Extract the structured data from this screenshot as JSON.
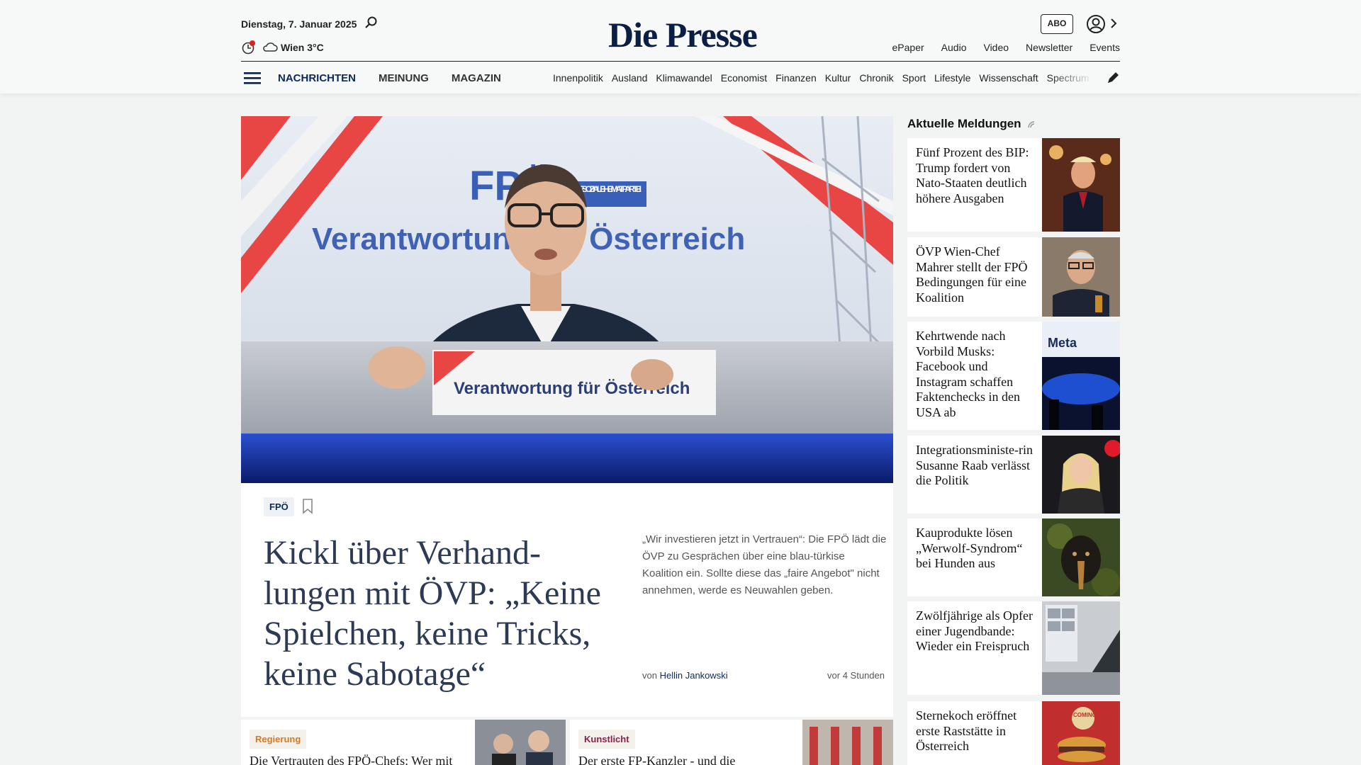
{
  "header": {
    "date": "Dienstag, 7. Januar 2025",
    "weather": "Wien 3°C",
    "logo": "Die Presse",
    "abo": "ABO",
    "links": [
      "ePaper",
      "Audio",
      "Video",
      "Newsletter",
      "Events"
    ]
  },
  "nav": {
    "main": [
      "NACHRICHTEN",
      "MEINUNG",
      "MAGAZIN"
    ],
    "sub": [
      "Innenpolitik",
      "Ausland",
      "Klimawandel",
      "Economist",
      "Finanzen",
      "Kultur",
      "Chronik",
      "Sport",
      "Lifestyle",
      "Wissenschaft",
      "Spectrum"
    ]
  },
  "hero": {
    "banner_text": "Verantwortung für Österreich",
    "podium_text": "Verantwortung für Österreich",
    "party": "FPÖ",
    "party_sub": "DIE SOZIALE HEIMATPARTEI"
  },
  "lead": {
    "tag": "FPÖ",
    "headline": "Kickl über Verhand-lungen mit ÖVP: „Keine Spielchen, keine Tricks, keine Sabotage“",
    "teaser": "„Wir investieren jetzt in Vertrauen“: Die FPÖ lädt die ÖVP zu Gesprächen über eine blau-türkise Koalition ein. Sollte diese das „faire Angebot\" nicht annehmen, werde es Neuwahlen geben.",
    "byline_prefix": "von",
    "author": "Hellin Jankowski",
    "age": "vor 4 Stunden"
  },
  "cards": [
    {
      "tag": "Regierung",
      "tag_color": "#d9791f",
      "title": "Die Vertrauten des FPÖ-Chefs: Wer mit"
    },
    {
      "tag": "Kunstlicht",
      "tag_color": "#8a1f4f",
      "title": "Der erste FP-Kanzler - und die"
    }
  ],
  "sidebar": {
    "title": "Aktuelle Meldungen",
    "items": [
      {
        "text": "Fünf Prozent des BIP: Trump fordert von Nato-Staaten deutlich höhere Ausgaben"
      },
      {
        "text": "ÖVP Wien-Chef Mahrer stellt der FPÖ Bedingungen für eine Koalition"
      },
      {
        "text": "Kehrtwende nach Vorbild Musks: Facebook und Instagram schaffen Faktenchecks in den USA ab",
        "img_text": "Meta"
      },
      {
        "text": "Integrationsministe-rin Susanne Raab verlässt die Politik"
      },
      {
        "text": "Kauprodukte lösen „Werwolf-Syndrom“ bei Hunden aus"
      },
      {
        "text": "Zwölfjährige als Opfer einer Jugendbande: Wieder ein Freispruch"
      },
      {
        "text": "Sternekoch eröffnet erste Raststätte in Österreich",
        "img_text": "COMING SOON!"
      }
    ]
  }
}
